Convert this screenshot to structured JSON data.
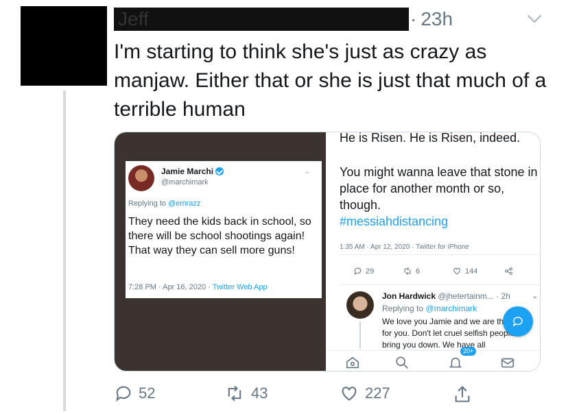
{
  "tweet": {
    "author_name": "Jeff",
    "separator": "·",
    "time": "23h",
    "text": "I'm starting to think she's just as crazy as manjaw. Either that or she is just that much of a terrible human",
    "actions": {
      "replies": "52",
      "retweets": "43",
      "likes": "227"
    }
  },
  "embedded_left": {
    "name": "Jamie Marchi",
    "handle": "@marchimark",
    "replying_prefix": "Replying to",
    "replying_to": "@emrazz",
    "body": "They need the kids back in school, so there will be school shootings again! That way they can sell more guns!",
    "meta_time": "7:28 PM · Apr 16, 2020 ·",
    "meta_source": "Twitter Web App"
  },
  "embedded_right": {
    "top_text": "He is Risen. He is Risen, indeed.",
    "body": "You might wanna leave that stone in place for another month or so, though.",
    "hashtag": "#messiahdistancing",
    "meta": "1:35 AM · Apr 12, 2020 · Twitter for iPhone",
    "actions": {
      "replies": "29",
      "retweets": "6",
      "likes": "144"
    },
    "reply": {
      "name": "Jon Hardwick",
      "handle_time": "@jhetertainm... · 2h",
      "replying_prefix": "Replying to",
      "replying_to": "@marchimark",
      "body": "We love you Jamie and we are there for you. Don't let cruel selfish people bring you down. We have all"
    },
    "notif_badge": "20+"
  },
  "colors": {
    "accent": "#1da1f2",
    "muted": "#657786",
    "dark_bg": "#3b3330"
  },
  "icons": [
    "chevron-down-icon",
    "verified-icon",
    "reply-icon",
    "retweet-icon",
    "like-icon",
    "share-icon",
    "compose-icon",
    "home-icon",
    "search-icon",
    "notifications-icon",
    "messages-icon"
  ]
}
